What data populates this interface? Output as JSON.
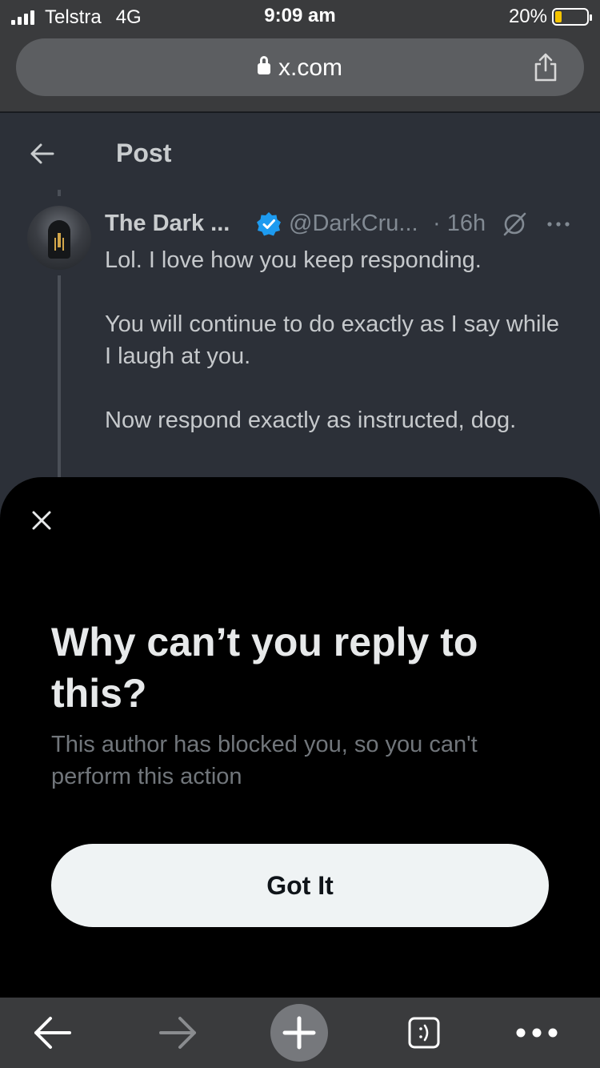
{
  "status_bar": {
    "carrier": "Telstra",
    "network": "4G",
    "time": "9:09 am",
    "battery_percent": "20%",
    "battery_level": 0.2
  },
  "browser": {
    "url": "x.com",
    "icons": {
      "lock": "lock-icon",
      "share": "share-icon"
    }
  },
  "header": {
    "title": "Post",
    "back_icon": "back-arrow-icon"
  },
  "tweet": {
    "display_name": "The Dark ...",
    "handle": "@DarkCru...",
    "time": "· 16h",
    "body": [
      "Lol. I love how you keep responding.",
      "You will continue to do exactly as I say while I laugh at you.",
      "Now respond exactly as instructed, dog."
    ],
    "icons": {
      "verified": "verified-badge-icon",
      "grok": "grok-icon",
      "more": "more-options-icon"
    }
  },
  "sheet": {
    "title": "Why can’t you reply to this?",
    "description": "This author has blocked you, so you can't perform this action",
    "button_label": "Got It",
    "close_icon": "close-icon"
  },
  "toolbar": {
    "items": [
      "back-icon",
      "forward-icon",
      "new-tab-icon",
      "tabs-icon",
      "more-icon"
    ]
  },
  "colors": {
    "sheet_bg": "#000000",
    "button_bg": "#eff3f4",
    "verified": "#1d9bf0",
    "battery": "#f5c400"
  }
}
